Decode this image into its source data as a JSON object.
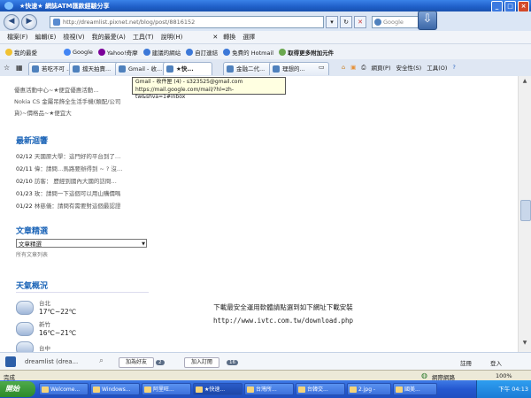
{
  "window": {
    "title": "★快速★ 網誌ATM匯款經驗分享",
    "controls": [
      "_",
      "□",
      "×"
    ]
  },
  "address": {
    "url": "http://dreamlist.pixnet.net/blog/post/8816152",
    "search_placeholder": "Google"
  },
  "menu": [
    "檔案(F)",
    "編輯(E)",
    "檢視(V)",
    "我的最愛(A)",
    "工具(T)",
    "說明(H)"
  ],
  "menu_right": [
    "轉換",
    "選擇"
  ],
  "fav_bar": {
    "label": "我的最愛",
    "items": [
      "Google",
      "Yahoo!奇摩",
      "建議的網站",
      "自訂連結",
      "免費的 Hotmail",
      "取得更多附加元件"
    ]
  },
  "tabs": [
    {
      "label": "若吃不可 ...",
      "active": false
    },
    {
      "label": "擋天拍賣...",
      "active": false
    },
    {
      "label": "Gmail - 收...",
      "active": false
    },
    {
      "label": "★快...",
      "active": true
    },
    {
      "label": "金融二代...",
      "active": false
    },
    {
      "label": "理想的...",
      "active": false
    }
  ],
  "tab_tools": [
    "網頁(P)",
    "安全性(S)",
    "工具(O)"
  ],
  "tooltip": {
    "line1": "Gmail - 收件匣 (4) - s323525@gmail.com",
    "line2": "https://mail.google.com/mail/?hl=zh-tw&shva=1#inbox"
  },
  "content": {
    "top_lines": [
      "優惠活動中心~★便宜優惠活動…",
      "Nokia CS 金屬吊飾全生活手機(類配/公司",
      "貨)~價格品~★便宜大"
    ],
    "latest_title": "最新迴響",
    "latest": [
      {
        "date": "02/12",
        "text": "天國原大學：這門好的平台到了…"
      },
      {
        "date": "02/11",
        "text": "偉：請問…馬路要辦得到 ~ ? 沒…"
      },
      {
        "date": "02/10",
        "text": "訪客：        歷經到國內大國的訪問…"
      },
      {
        "date": "01/23",
        "text": "玫：請問一下這個可以用山購價嗎"
      },
      {
        "date": "01/22",
        "text": "林慈儀：請問有需要對這個最認證"
      }
    ],
    "featured_title": "文章精選",
    "featured_select": "文章精選",
    "all_articles": "所有文章列表",
    "weather_title": "天氣概況",
    "weather": [
      {
        "city": "台北",
        "temp": "17℃~22℃"
      },
      {
        "city": "新竹",
        "temp": "16℃~21℃"
      },
      {
        "city": "台中",
        "temp": ""
      }
    ],
    "center_line1": "下載最安全運用軟體請點選到如下網址下載安裝",
    "center_line2": "http://www.ivtc.com.tw/download.php"
  },
  "pixnet_bar": {
    "blog": "dreamlist (drea...",
    "add_friend": "加為好友",
    "add_friend_count": "2",
    "subscribe": "加入訂閱",
    "subscribe_count": "16",
    "right1": "註冊",
    "right2": "登入"
  },
  "status": {
    "text": "完成",
    "zone": "網際網路",
    "zoom": "100%"
  },
  "taskbar": {
    "start": "開始",
    "tasks": [
      "Welcome...",
      "Windows...",
      "阿里旺...",
      "★快速...",
      "台灣所...",
      "台韓交...",
      "2.jpg -",
      "國美..."
    ],
    "clock": "下午 04:13"
  }
}
